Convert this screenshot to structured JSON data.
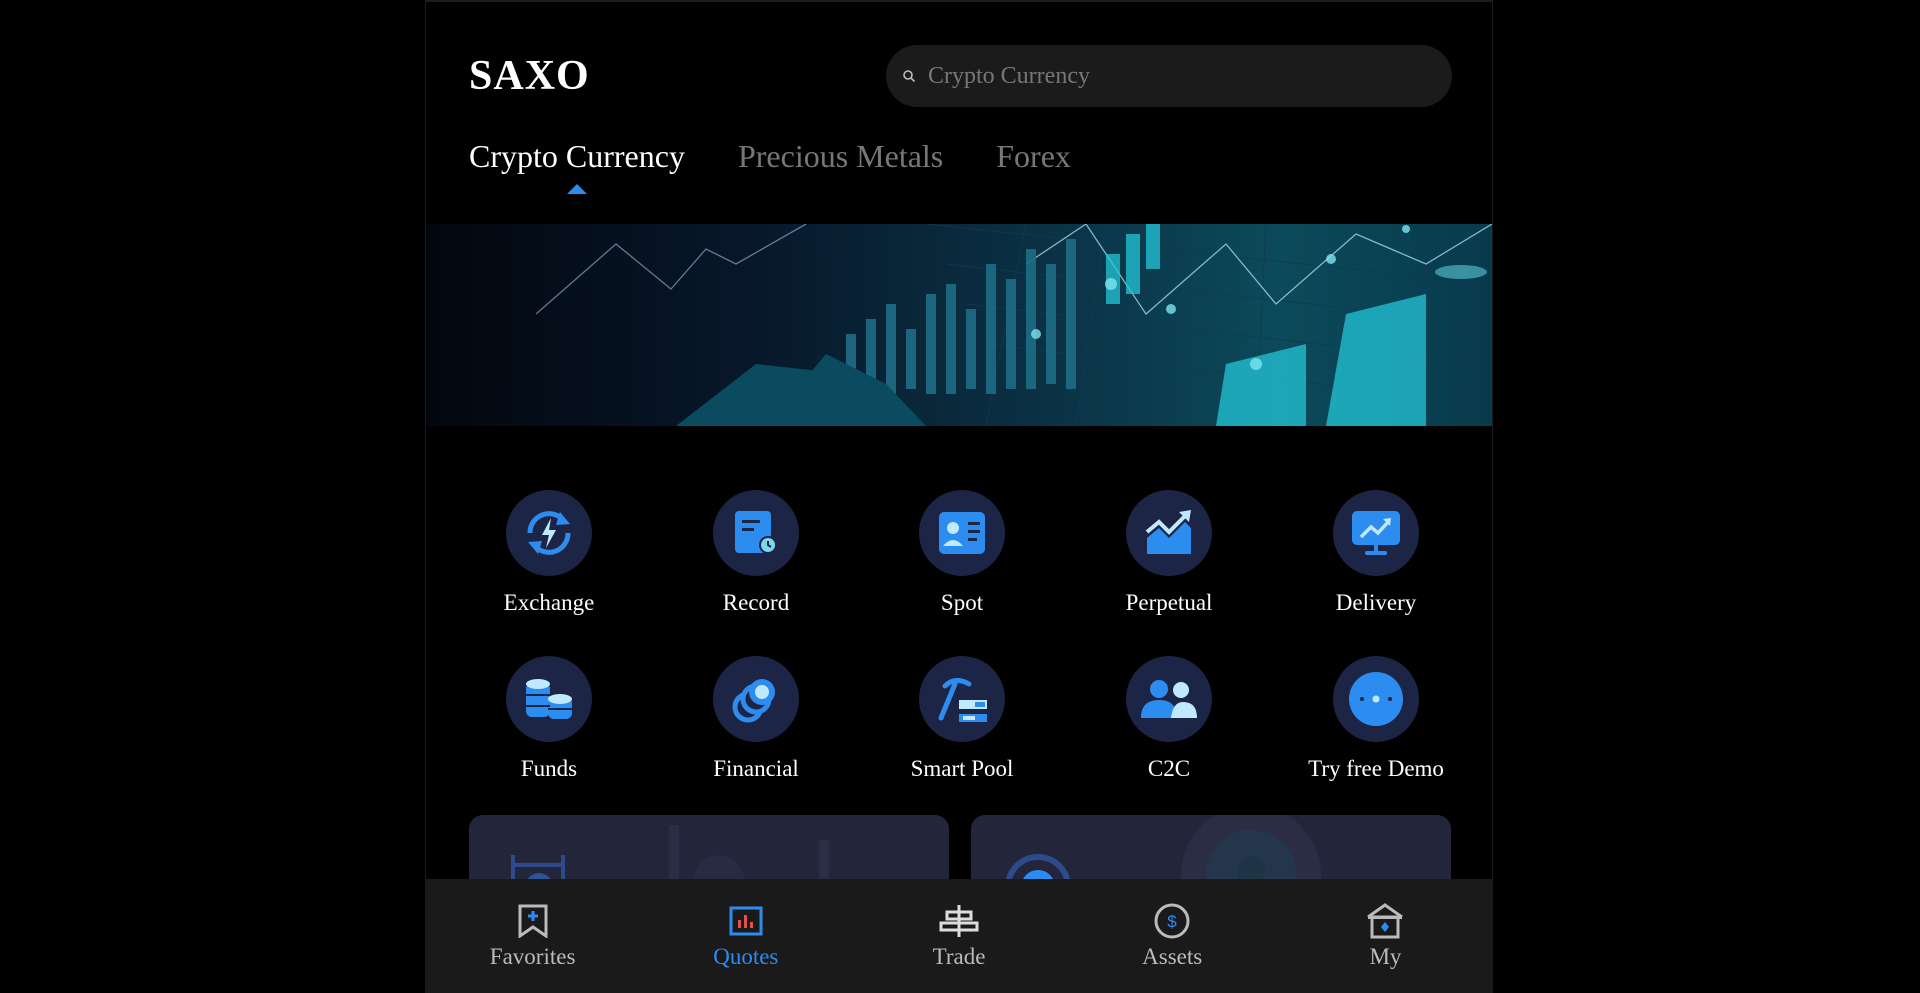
{
  "brand": "SAXO",
  "search": {
    "placeholder": "Crypto Currency"
  },
  "tabs": [
    {
      "label": "Crypto Currency",
      "active": true
    },
    {
      "label": "Precious Metals",
      "active": false
    },
    {
      "label": "Forex",
      "active": false
    }
  ],
  "grid": [
    {
      "label": "Exchange",
      "icon": "exchange-icon"
    },
    {
      "label": "Record",
      "icon": "record-icon"
    },
    {
      "label": "Spot",
      "icon": "spot-icon"
    },
    {
      "label": "Perpetual",
      "icon": "perpetual-icon"
    },
    {
      "label": "Delivery",
      "icon": "delivery-icon"
    },
    {
      "label": "Funds",
      "icon": "funds-icon"
    },
    {
      "label": "Financial",
      "icon": "financial-icon"
    },
    {
      "label": "Smart Pool",
      "icon": "smart-pool-icon"
    },
    {
      "label": "C2C",
      "icon": "c2c-icon"
    },
    {
      "label": "Try free Demo",
      "icon": "demo-icon"
    }
  ],
  "bottom_nav": [
    {
      "label": "Favorites",
      "icon": "bookmark-plus-icon",
      "active": false
    },
    {
      "label": "Quotes",
      "icon": "bar-chart-icon",
      "active": true
    },
    {
      "label": "Trade",
      "icon": "trade-icon",
      "active": false
    },
    {
      "label": "Assets",
      "icon": "dollar-circle-icon",
      "active": false
    },
    {
      "label": "My",
      "icon": "home-icon",
      "active": false
    }
  ],
  "colors": {
    "accent": "#2d8cf0",
    "icon_bg": "#1c2545",
    "nav_bg": "#1a1a1a",
    "card_bg": "#23253a",
    "teal": "#4fd1c5"
  }
}
